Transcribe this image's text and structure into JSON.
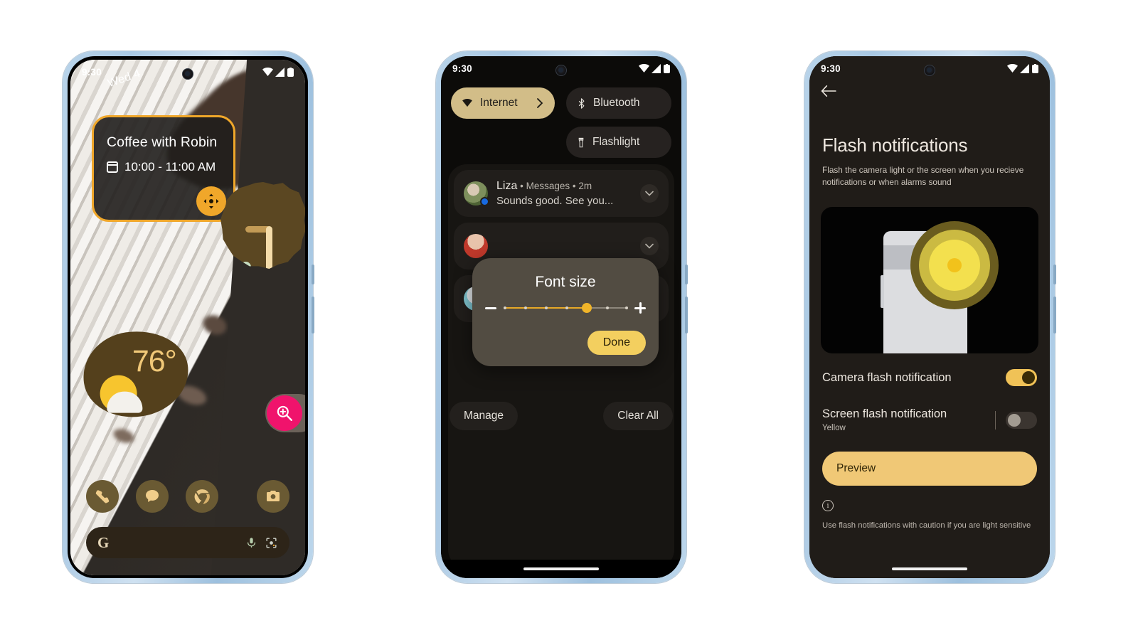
{
  "phones": {
    "home": {
      "status": {
        "time": "9:30",
        "icons": [
          "wifi-icon",
          "cellular-icon",
          "battery-icon"
        ]
      },
      "calendar_widget": {
        "title": "Coffee with Robin",
        "time": "10:00 - 11:00 AM",
        "icon": "calendar-icon",
        "resize_handle_icon": "move-resize-icon",
        "outline_color": "#f0a72a"
      },
      "clock_widget": {
        "date": "Wed 4"
      },
      "weather_widget": {
        "temperature": "76°",
        "icon": "partly-sunny-icon"
      },
      "magnifier_fab": {
        "icon": "magnifier-plus-icon",
        "color": "#f0136c"
      },
      "dock": [
        {
          "name": "phone-app",
          "icon": "phone-icon"
        },
        {
          "name": "messages-app",
          "icon": "chat-bubble-icon"
        },
        {
          "name": "chrome-app",
          "icon": "chrome-icon"
        },
        {
          "name": "camera-app",
          "icon": "camera-icon"
        }
      ],
      "search": {
        "logo": "G",
        "placeholder": "",
        "mic_icon": "microphone-icon",
        "lens_icon": "google-lens-icon"
      }
    },
    "quicksettings": {
      "status": {
        "time": "9:30"
      },
      "tiles": [
        {
          "label": "Internet",
          "icon": "wifi-icon",
          "state": "active",
          "chevron": "chevron-right-icon"
        },
        {
          "label": "Bluetooth",
          "icon": "bluetooth-icon",
          "state": "inactive"
        },
        {
          "label": "Flashlight",
          "icon": "flashlight-icon",
          "state": "inactive"
        }
      ],
      "notifications": [
        {
          "app": "Liza",
          "meta": "• Messages • 2m",
          "body": "Sounds good. See you...",
          "avatar": "avatar-liza",
          "badge": true
        },
        {
          "app": "",
          "meta": "",
          "body": "",
          "avatar": "avatar-2",
          "badge": false
        },
        {
          "app": "",
          "meta": "",
          "body": "",
          "avatar": "avatar-3",
          "badge": false
        }
      ],
      "actions": {
        "manage": "Manage",
        "clear_all": "Clear All"
      },
      "font_size_dialog": {
        "title": "Font size",
        "decrease_icon": "minus-icon",
        "increase_icon": "plus-icon",
        "done_label": "Done",
        "steps": 7,
        "value_index": 4
      }
    },
    "settings": {
      "status": {
        "time": "9:30"
      },
      "back_icon": "arrow-back-icon",
      "title": "Flash notifications",
      "description": "Flash the camera light or the screen when you recieve notifications or when alarms sound",
      "hero_alt": "phone-with-camera-flash-illustration",
      "rows": [
        {
          "label": "Camera flash notification",
          "sub": "",
          "toggle": "on"
        },
        {
          "label": "Screen flash notification",
          "sub": "Yellow",
          "toggle": "off"
        }
      ],
      "preview_label": "Preview",
      "info_icon": "info-icon",
      "caution": "Use flash notifications with caution if you are light sensitive"
    }
  }
}
